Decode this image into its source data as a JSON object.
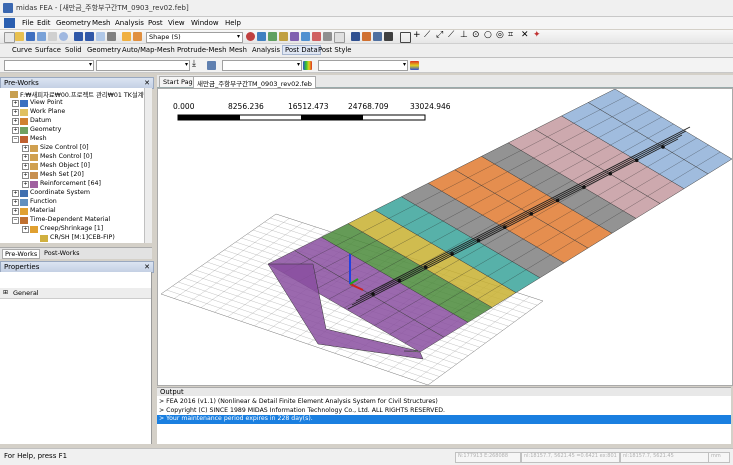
{
  "window": {
    "title": "midas FEA - [새만금_주항부구간TM_0903_rev02.feb]"
  },
  "menu": [
    "File",
    "Edit",
    "Geometry",
    "Mesh",
    "Analysis",
    "Post",
    "View",
    "Window",
    "Help"
  ],
  "toolbar": {
    "shape_combo": "Shape (S)"
  },
  "ribbon_tabs": [
    "Curve",
    "Surface",
    "Solid",
    "Geometry",
    "Auto/Map-Mesh",
    "Protrude-Mesh",
    "Mesh",
    "Analysis",
    "Post Data",
    "Post Style"
  ],
  "ribbon_active": "Post Data",
  "preworks": {
    "header": "Pre-Works",
    "close": "✕",
    "tree": [
      {
        "label": "F:₩새피자료₩00.프로젝트 관리₩01 TK설계₩",
        "depth": 0
      },
      {
        "label": "View Point",
        "depth": 1
      },
      {
        "label": "Work Plane",
        "depth": 1
      },
      {
        "label": "Datum",
        "depth": 1
      },
      {
        "label": "Geometry",
        "depth": 1
      },
      {
        "label": "Mesh",
        "depth": 1
      },
      {
        "label": "Size Control [0]",
        "depth": 2
      },
      {
        "label": "Mesh Control [0]",
        "depth": 2
      },
      {
        "label": "Mesh Object [0]",
        "depth": 2
      },
      {
        "label": "Mesh Set [20]",
        "depth": 2
      },
      {
        "label": "Reinforcement [64]",
        "depth": 2
      },
      {
        "label": "Coordinate System",
        "depth": 1
      },
      {
        "label": "Function",
        "depth": 1
      },
      {
        "label": "Material",
        "depth": 1
      },
      {
        "label": "Time-Dependent Material",
        "depth": 1
      },
      {
        "label": "Creep/Shrinkage [1]",
        "depth": 2
      },
      {
        "label": "CR/SH [M:1]CEB-FIP)",
        "depth": 3
      }
    ]
  },
  "left_tabs": [
    "Pre-Works",
    "Post-Works"
  ],
  "properties": {
    "header": "Properties",
    "group": "General"
  },
  "doc_tabs": [
    "Start Page",
    "새만금_주항부구간TM_0903_rev02.feb"
  ],
  "scale_bar": {
    "ticks": [
      "0.000",
      "8256.236",
      "16512.473",
      "24768.709",
      "33024.946"
    ]
  },
  "model_colors": [
    "#8a4fa0",
    "#4a8a3a",
    "#c8b030",
    "#3aa39a",
    "#e07a30",
    "#c49aa0",
    "#8fb0d8",
    "#808080"
  ],
  "output": {
    "header": "Output",
    "lines": [
      "> FEA 2016 (v1.1) (Nonlinear & Detail Finite Element Analysis System for Civil Structures)",
      "> Copyright (C) SINCE 1989 MIDAS Information Technology Co., Ltd. ALL RIGHTS RESERVED.",
      "> Your maintenance period expires in 228 day(s)."
    ]
  },
  "status": {
    "help": "For Help, press F1",
    "fields": [
      "N:177913  E:268088",
      "nl:18157.7, 5621.45 =0.6421 ex:801",
      "nl:18157.7, 5621.45",
      "mm"
    ]
  }
}
